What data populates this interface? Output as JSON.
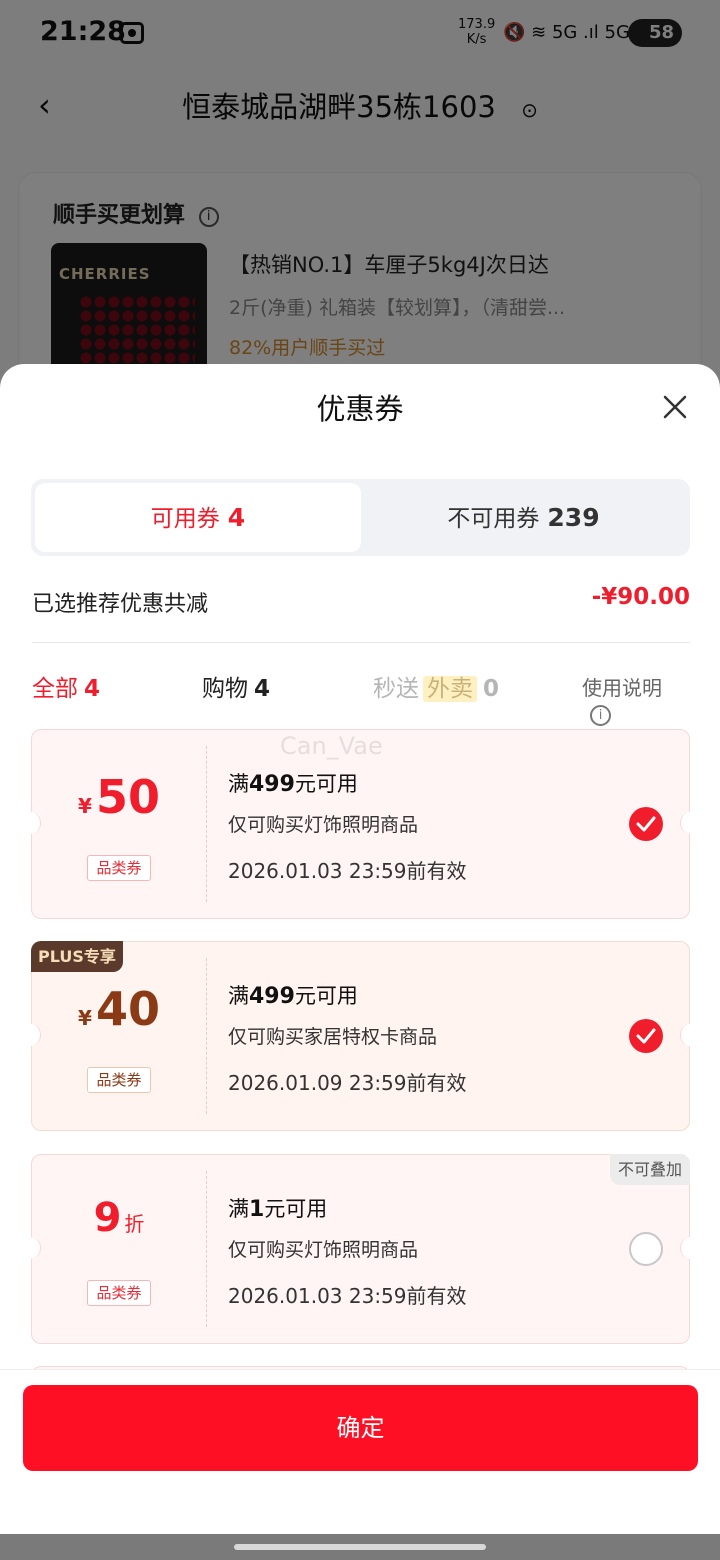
{
  "status_bar": {
    "time": "21:28",
    "speed_value": "173.9",
    "speed_unit": "K/s",
    "icons": "🔇 ≋ 5G .ıl 5G .ıl",
    "battery": "58"
  },
  "nav": {
    "back_icon": "‹",
    "title": "恒泰城品湖畔35栋1603",
    "pin_icon": "⊙"
  },
  "bg_card": {
    "title": "顺手买更划算",
    "info_icon": "i",
    "thumb_text": "CHERRIES",
    "product_title": "【热销NO.1】车厘子5kg4J次日达",
    "product_sub": "2斤(净重) 礼箱装【较划算】，（清甜尝...",
    "product_tag": "82%用户顺手买过"
  },
  "sheet": {
    "title": "优惠券",
    "tabs": [
      {
        "label": "可用券",
        "count": "4"
      },
      {
        "label": "不可用券",
        "count": "239"
      }
    ],
    "summary_label": "已选推荐优惠共减",
    "summary_value": "-¥90.00",
    "filters": {
      "all_label": "全部",
      "all_count": "4",
      "shop_label": "购物",
      "shop_count": "4",
      "miao_label": "秒送",
      "waimai_label": "外卖",
      "miao_count": "0",
      "help_label": "使用说明",
      "help_icon": "i"
    },
    "watermark": "Can_Vae",
    "coupons": [
      {
        "yen": "¥",
        "amount": "50",
        "tag": "品类券",
        "cond_pre": "满",
        "cond_num": "499",
        "cond_post": "元可用",
        "scope": "仅可购买灯饰照明商品",
        "expiry": "2026.01.03 23:59前有效",
        "selected": true
      },
      {
        "badge": "PLUS专享",
        "yen": "¥",
        "amount": "40",
        "tag": "品类券",
        "cond_pre": "满",
        "cond_num": "499",
        "cond_post": "元可用",
        "scope": "仅可购买家居特权卡商品",
        "expiry": "2026.01.09 23:59前有效",
        "selected": true
      },
      {
        "badge_right": "不可叠加",
        "amount": "9",
        "unit": "折",
        "tag": "品类券",
        "cond_pre": "满",
        "cond_num": "1",
        "cond_post": "元可用",
        "scope": "仅可购买灯饰照明商品",
        "expiry": "2026.01.03 23:59前有效",
        "selected": false
      }
    ],
    "confirm_label": "确定"
  },
  "colors": {
    "accent_red": "#f01e2c",
    "button_red": "#ff0f23",
    "plus_brown": "#5b3a2c"
  }
}
